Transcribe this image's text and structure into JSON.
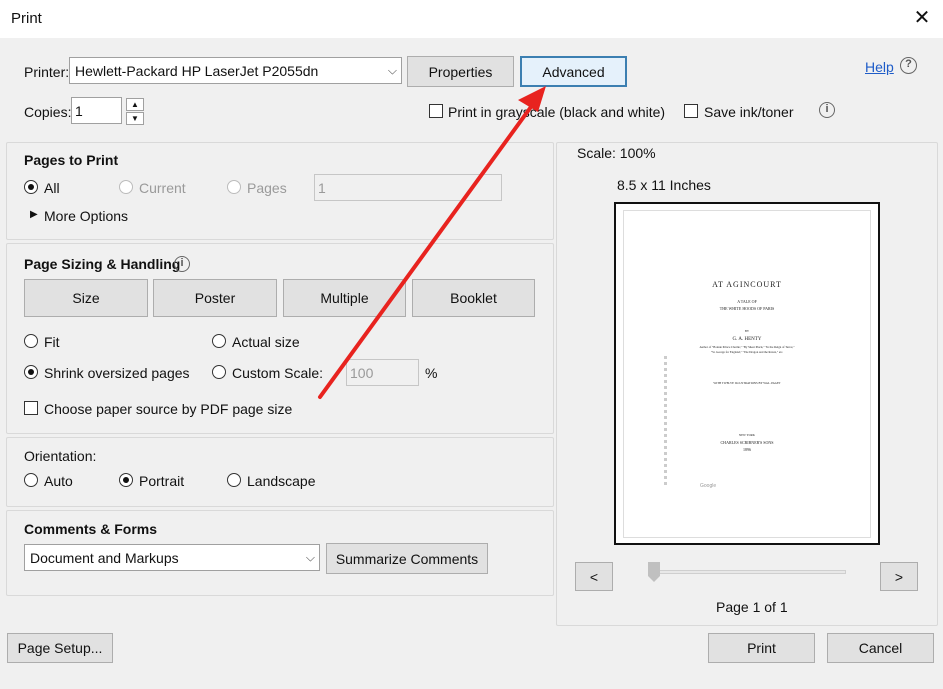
{
  "window": {
    "title": "Print",
    "close_glyph": "✕"
  },
  "printer": {
    "label": "Printer:",
    "selected": "Hewlett-Packard HP LaserJet P2055dn",
    "properties_label": "Properties",
    "advanced_label": "Advanced",
    "help_label": "Help"
  },
  "copies": {
    "label": "Copies:",
    "value": "1"
  },
  "options": {
    "grayscale_label": "Print in grayscale (black and white)",
    "save_ink_label": "Save ink/toner"
  },
  "pages_to_print": {
    "heading": "Pages to Print",
    "all_label": "All",
    "current_label": "Current",
    "pages_label": "Pages",
    "pages_value": "1",
    "more_options_label": "More Options",
    "selected": "All"
  },
  "sizing": {
    "heading": "Page Sizing & Handling",
    "tabs": [
      "Size",
      "Poster",
      "Multiple",
      "Booklet"
    ],
    "fit_label": "Fit",
    "actual_label": "Actual size",
    "shrink_label": "Shrink oversized pages",
    "custom_label": "Custom Scale:",
    "custom_value": "100",
    "percent": "%",
    "paper_source_label": "Choose paper source by PDF page size",
    "selected": "Shrink oversized pages"
  },
  "orientation": {
    "heading": "Orientation:",
    "auto_label": "Auto",
    "portrait_label": "Portrait",
    "landscape_label": "Landscape",
    "selected": "Portrait"
  },
  "comments": {
    "heading": "Comments & Forms",
    "selected": "Document and Markups",
    "summarize_label": "Summarize Comments"
  },
  "preview": {
    "scale": "Scale: 100%",
    "paper": "8.5 x 11 Inches",
    "prev": "<",
    "next": ">",
    "page_info": "Page 1 of 1",
    "doc": {
      "title": "AT AGINCOURT",
      "subtitle1": "A TALE OF",
      "subtitle2": "THE WHITE HOODS OF PARIS",
      "by": "BY",
      "author": "G. A. HENTY",
      "credits1": "Author of \"Bonnie Prince Charlie,\" \"By Sheer Pluck,\" \"In the Reign of Terror,\"",
      "credits2": "\"St. George for England,\" \"The Dragon and the Raven,\" etc.",
      "illus": "WITH TWELVE ILLUSTRATIONS BY WAL. PAGET",
      "place": "NEW YORK",
      "publisher": "CHARLES SCRIBNER'S SONS",
      "year": "1896",
      "google": "Google"
    }
  },
  "footer": {
    "page_setup_label": "Page Setup...",
    "print_label": "Print",
    "cancel_label": "Cancel"
  },
  "colors": {
    "arrow": "#e8231f",
    "link": "#1e5cc8",
    "focus": "#3c7fb1"
  }
}
